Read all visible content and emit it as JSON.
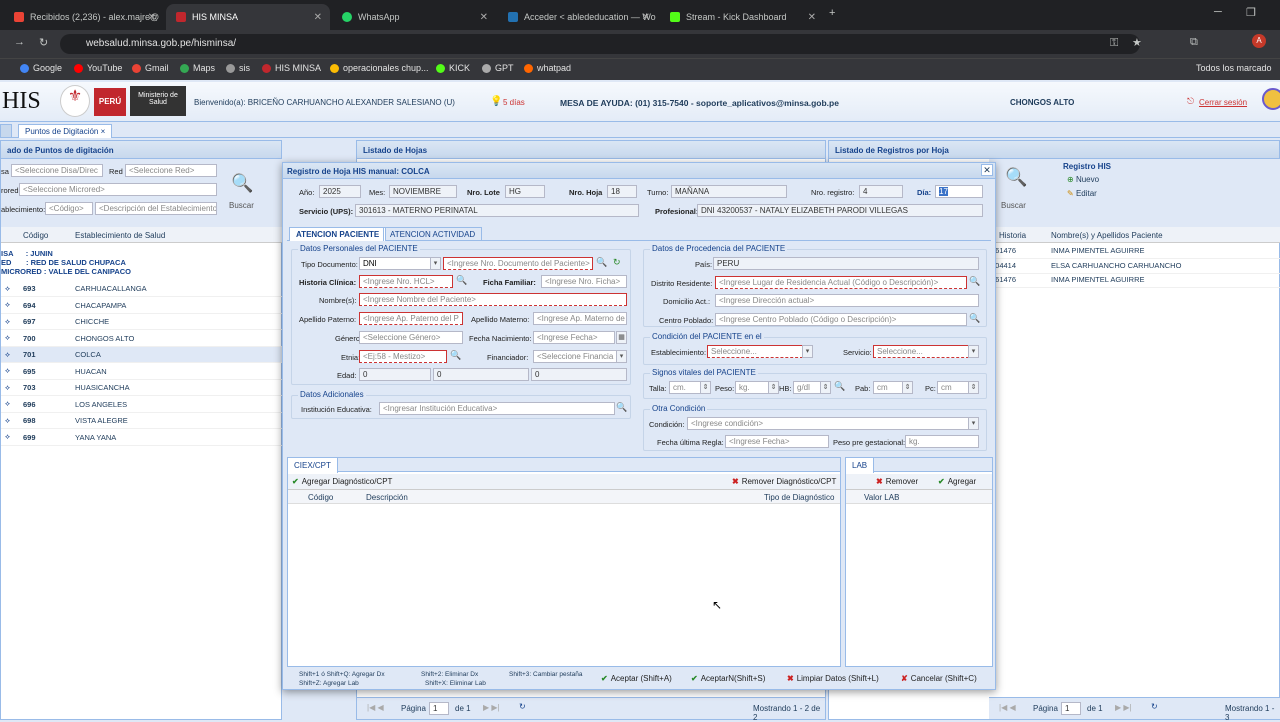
{
  "browser": {
    "tabs": [
      {
        "label": "Recibidos (2,236) - alex.majre@"
      },
      {
        "label": "HIS MINSA"
      },
      {
        "label": "WhatsApp"
      },
      {
        "label": "Acceder < ablededucation — Wo"
      },
      {
        "label": "Stream - Kick Dashboard"
      }
    ],
    "url": "websalud.minsa.gob.pe/hisminsa/",
    "bookmarks": [
      "Google",
      "YouTube",
      "Gmail",
      "Maps",
      "sis",
      "HIS MINSA",
      "operacionales chup...",
      "KICK",
      "GPT",
      "whatpad"
    ],
    "all_bookmarks": "Todos los marcado"
  },
  "header": {
    "logo": "HIS",
    "peru": "PERÚ",
    "ministry": "Ministerio de Salud",
    "welcome": "Bienvenido(a): BRICEÑO CARHUANCHO ALEXANDER SALESIANO (U)",
    "days": "5 días",
    "help": "MESA DE AYUDA: (01) 315-7540 - soporte_aplicativos@minsa.gob.pe",
    "location": "CHONGOS ALTO",
    "logout": "Cerrar sesión"
  },
  "tabs": {
    "points": "Puntos de Digitación"
  },
  "left": {
    "title": "ado de Puntos de digitación",
    "disa_lbl": "sa",
    "disa_ph": "<Seleccione Disa/Direc",
    "red_lbl": "Red",
    "red_ph": "<Seleccione Red>",
    "micro_lbl": "rored",
    "micro_ph": "<Seleccione Microred>",
    "estab_lbl": "ablecimiento:",
    "code_ph": "<Código>",
    "desc_ph": "<Descripción del Establecimiento",
    "buscar": "Buscar",
    "col_code": "Código",
    "col_estab": "Establecimiento de Salud",
    "group": [
      "ISA      : JUNIN",
      "ED       : RED DE SALUD CHUPACA",
      "MICRORED : VALLE DEL CANIPACO"
    ],
    "rows": [
      {
        "code": "693",
        "name": "CARHUACALLANGA"
      },
      {
        "code": "694",
        "name": "CHACAPAMPA"
      },
      {
        "code": "697",
        "name": "CHICCHE"
      },
      {
        "code": "700",
        "name": "CHONGOS ALTO"
      },
      {
        "code": "701",
        "name": "COLCA"
      },
      {
        "code": "695",
        "name": "HUACAN"
      },
      {
        "code": "703",
        "name": "HUASICANCHA"
      },
      {
        "code": "696",
        "name": "LOS ANGELES"
      },
      {
        "code": "698",
        "name": "VISTA ALEGRE"
      },
      {
        "code": "699",
        "name": "YANA YANA"
      }
    ]
  },
  "mid": {
    "title": "Listado de Hojas",
    "pager": {
      "page": "Página",
      "num": "1",
      "of": "de 1",
      "showing": "Mostrando 1 - 2 de 2"
    }
  },
  "right": {
    "title": "Listado de Registros por Hoja",
    "registro": "Registro HIS",
    "nuevo": "Nuevo",
    "editar": "Editar",
    "buscar": "Buscar",
    "col_hist": "Historia",
    "col_name": "Nombre(s) y Apellidos Paciente",
    "rows": [
      {
        "hist": "861476",
        "name": "INMA PIMENTEL AGUIRRE"
      },
      {
        "hist": "504414",
        "name": "ELSA CARHUANCHO CARHUANCHO"
      },
      {
        "hist": "861476",
        "name": "INMA PIMENTEL AGUIRRE"
      }
    ],
    "pager": {
      "page": "Página",
      "num": "1",
      "of": "de 1",
      "showing": "Mostrando 1 - 3"
    }
  },
  "modal": {
    "title": "Registro de Hoja HIS manual: COLCA",
    "anio_lbl": "Año:",
    "anio": "2025",
    "mes_lbl": "Mes:",
    "mes": "NOVIEMBRE",
    "lote_lbl": "Nro. Lote",
    "lote": "HG",
    "hoja_lbl": "Nro. Hoja",
    "hoja": "18",
    "turno_lbl": "Turno:",
    "turno": "MAÑANA",
    "reg_lbl": "Nro. registro:",
    "reg": "4",
    "dia_lbl": "Día:",
    "dia": "17",
    "serv_lbl": "Servicio (UPS):",
    "serv": "301613 - MATERNO PERINATAL",
    "prof_lbl": "Profesional:",
    "prof": "DNI 43200537 - NATALY ELIZABETH PARODI VILLEGAS",
    "tab1": "ATENCION PACIENTE",
    "tab2": "ATENCION ACTIVIDAD",
    "dp": {
      "legend": "Datos Personales del PACIENTE",
      "tipo_lbl": "Tipo Documento:",
      "tipo": "DNI",
      "doc_ph": "<Ingrese Nro. Documento del Paciente>",
      "hc_lbl": "Historia Clínica:",
      "hc_ph": "<Ingrese Nro. HCL>",
      "ff_lbl": "Ficha Familiar:",
      "ff_ph": "<Ingrese Nro. Ficha>",
      "nom_lbl": "Nombre(s):",
      "nom_ph": "<Ingrese Nombre del Paciente>",
      "ap_lbl": "Apellido Paterno:",
      "ap_ph": "<Ingrese Ap. Paterno del P",
      "am_lbl": "Apellido Materno:",
      "am_ph": "<Ingrese Ap. Materno de",
      "gen_lbl": "Género:",
      "gen_ph": "<Seleccione Género>",
      "fn_lbl": "Fecha Nacimiento:",
      "fn_ph": "<Ingrese Fecha>",
      "et_lbl": "Etnia:",
      "et_ph": "<Ej:58 - Mestizo>",
      "fin_lbl": "Financiador:",
      "fin_ph": "<Seleccione Financia",
      "edad_lbl": "Edad:",
      "e1": "0",
      "e2": "0",
      "e3": "0"
    },
    "da": {
      "legend": "Datos Adicionales",
      "ie_lbl": "Institución Educativa:",
      "ie_ph": "<Ingresar Institución Educativa>"
    },
    "proc": {
      "legend": "Datos de Procedencia del PACIENTE",
      "pais_lbl": "País:",
      "pais": "PERU",
      "dr_lbl": "Distrito Residente:",
      "dr_ph": "<Ingrese Lugar de Residencia Actual (Código o Descripción)>",
      "dom_lbl": "Domicilio Act.:",
      "dom_ph": "<Ingrese Dirección actual>",
      "cp_lbl": "Centro Poblado:",
      "cp_ph": "<Ingrese Centro Poblado (Código o Descripción)>"
    },
    "cond": {
      "legend": "Condición del PACIENTE en el",
      "est_lbl": "Establecimiento:",
      "est_ph": "Seleccione...",
      "ser_lbl": "Servicio:",
      "ser_ph": "Seleccione..."
    },
    "sv": {
      "legend": "Signos vitales del PACIENTE",
      "talla": "Talla:",
      "talla_ph": "cm.",
      "peso": "Peso:",
      "peso_ph": "kg.",
      "hb": "HB:",
      "hb_ph": "g/dl",
      "pab": "Pab:",
      "pab_ph": "cm",
      "pc": "Pc:",
      "pc_ph": "cm"
    },
    "oc": {
      "legend": "Otra Condición",
      "c_lbl": "Condición:",
      "c_ph": "<Ingrese condición>",
      "fur_lbl": "Fecha última Regla:",
      "fur_ph": "<Ingrese Fecha>",
      "pp_lbl": "Peso pre gestacional:",
      "pp_ph": "kg."
    },
    "ciex": {
      "tab": "CIEX/CPT",
      "add": "Agregar Diagnóstico/CPT",
      "remove": "Remover Diagnóstico/CPT",
      "col1": "Código",
      "col2": "Descripción",
      "col3": "Tipo de Diagnóstico"
    },
    "lab": {
      "tab": "LAB",
      "remove": "Remover",
      "add": "Agregar",
      "col": "Valor LAB"
    },
    "shortcuts": [
      "Shift+1 ó Shift+Q: Agregar Dx",
      "Shift+Z: Agregar Lab",
      "Shift+2: Eliminar Dx",
      "Shift+X: Eliminar Lab",
      "Shift+3: Cambiar pestaña"
    ],
    "btns": {
      "ok": "Aceptar (Shift+A)",
      "okn": "AceptarN(Shift+S)",
      "clear": "Limpiar Datos (Shift+L)",
      "cancel": "Cancelar (Shift+C)"
    }
  },
  "colors": {
    "accent": "#15428b",
    "panel": "#dfe8f6",
    "required": "#cc3333"
  }
}
